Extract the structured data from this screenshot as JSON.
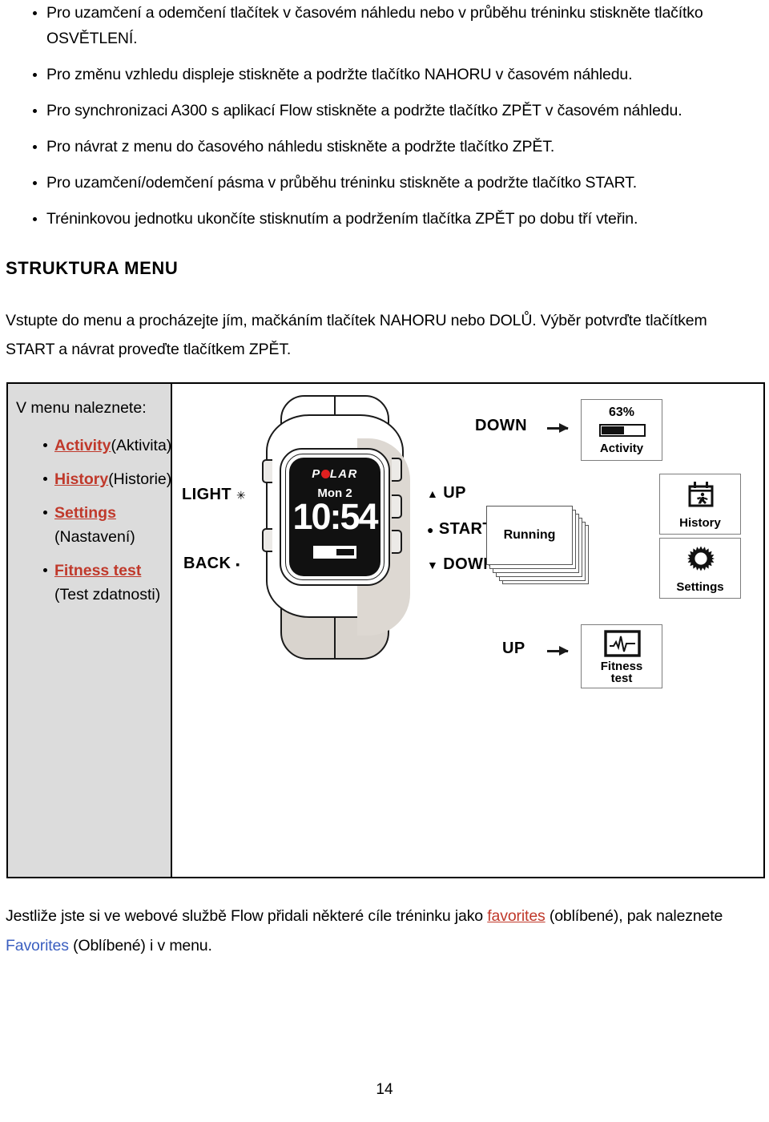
{
  "bullets": [
    "Pro uzamčení a odemčení tlačítek v časovém náhledu nebo v průběhu tréninku stiskněte tlačítko OSVĚTLENÍ.",
    "Pro změnu vzhledu displeje stiskněte a podržte tlačítko NAHORU v časovém náhledu.",
    "Pro synchronizaci A300 s aplikací Flow stiskněte a podržte tlačítko ZPĚT v časovém náhledu.",
    "Pro návrat z menu do časového náhledu stiskněte a podržte tlačítko ZPĚT.",
    "Pro uzamčení/odemčení pásma v průběhu tréninku stiskněte a podržte tlačítko START.",
    "Tréninkovou jednotku ukončíte stisknutím a podržením tlačítka ZPĚT po dobu tří vteřin."
  ],
  "heading": "STRUKTURA MENU",
  "intro": "Vstupte do menu a procházejte jím, mačkáním tlačítek NAHORU nebo DOLŮ. Výběr potvrďte tlačítkem START a návrat proveďte tlačítkem ZPĚT.",
  "table": {
    "left_title": "V menu naleznete:",
    "items": [
      {
        "link": "Activity",
        "rest": "(Aktivita)"
      },
      {
        "link": "History",
        "rest": "(Historie)"
      },
      {
        "link": "Settings",
        "rest": "(Nastavení)"
      },
      {
        "link": "Fitness test",
        "rest": "(Test zdatnosti)"
      }
    ]
  },
  "watch": {
    "brand": "P",
    "brand_rest": "LAR",
    "date": "Mon 2",
    "time": "10:54",
    "buttons": {
      "light": "LIGHT",
      "back": "BACK",
      "up": "UP",
      "start": "START",
      "down": "DOWN"
    },
    "glyphs": {
      "light": "✳",
      "back": "▪",
      "up": "▲",
      "start": "●",
      "down": "▼"
    }
  },
  "diagram": {
    "nav_down_top": "DOWN",
    "nav_up_bottom": "UP",
    "activity": {
      "percent": "63%",
      "label": "Activity"
    },
    "running": {
      "label": "Running"
    },
    "history": {
      "label": "History"
    },
    "settings": {
      "label": "Settings"
    },
    "fitness": {
      "label_line1": "Fitness",
      "label_line2": "test"
    }
  },
  "footer": {
    "part1": "Jestliže jste si ve webové službě Flow přidali některé cíle tréninku jako ",
    "link_red": "favorites",
    "part2": " (oblíbené), pak naleznete ",
    "link_blue": "Favorites",
    "part3": " (Oblíbené) i v menu."
  },
  "page_number": "14",
  "colors": {
    "link_red": "#c0392b",
    "link_blue": "#3b5fc0",
    "polar_red": "#e02020",
    "table_shade": "#dcdcdc"
  }
}
